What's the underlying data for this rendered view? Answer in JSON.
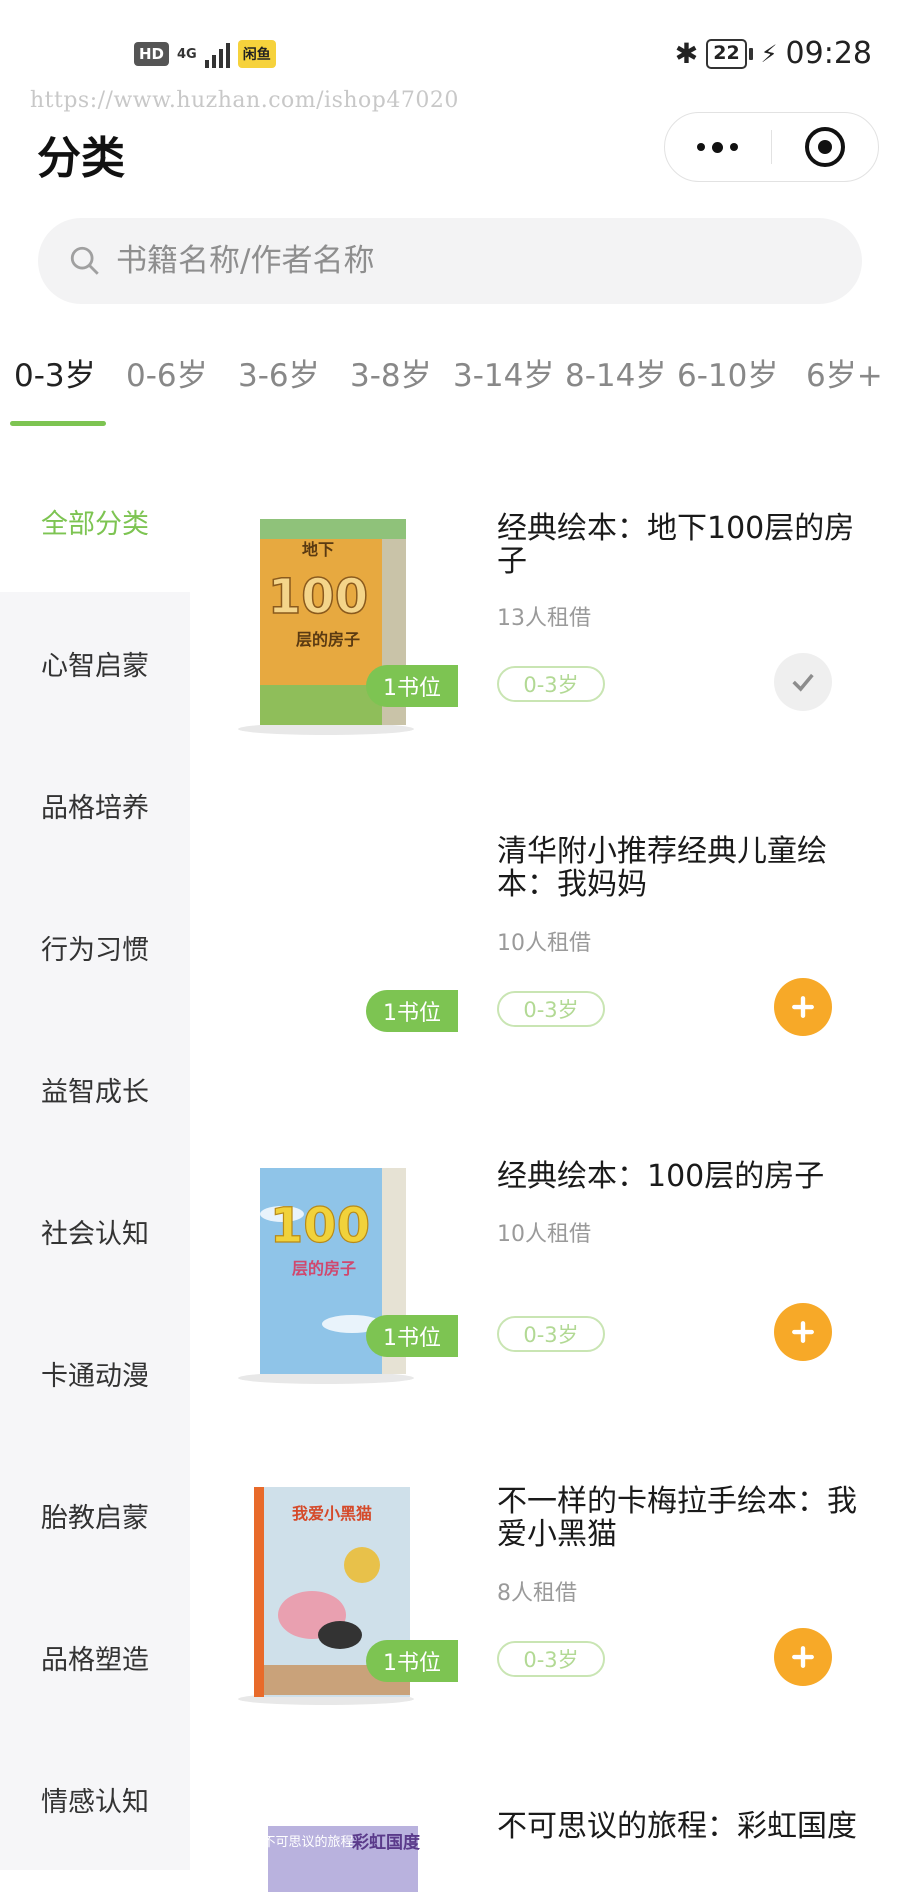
{
  "status_bar": {
    "hd": "HD",
    "network": "4G",
    "app_badge": "闲鱼",
    "battery": "22",
    "time": "09:28",
    "icons": [
      "signal-icon",
      "bluetooth-icon",
      "battery-icon",
      "charging-icon"
    ]
  },
  "watermark": "https://www.huzhan.com/ishop47020",
  "header": {
    "title": "分类",
    "menu_icon": "more-dots-icon",
    "close_icon": "mini-program-close-icon"
  },
  "search": {
    "placeholder": "书籍名称/作者名称",
    "icon": "search-icon"
  },
  "age_tabs": [
    {
      "label": "0-3岁",
      "active": true
    },
    {
      "label": "0-6岁",
      "active": false
    },
    {
      "label": "3-6岁",
      "active": false
    },
    {
      "label": "3-8岁",
      "active": false
    },
    {
      "label": "3-14岁",
      "active": false
    },
    {
      "label": "8-14岁",
      "active": false
    },
    {
      "label": "6-10岁",
      "active": false
    },
    {
      "label": "6岁+",
      "active": false
    }
  ],
  "categories": [
    {
      "label": "全部分类",
      "active": true
    },
    {
      "label": "心智启蒙",
      "active": false
    },
    {
      "label": "品格培养",
      "active": false
    },
    {
      "label": "行为习惯",
      "active": false
    },
    {
      "label": "益智成长",
      "active": false
    },
    {
      "label": "社会认知",
      "active": false
    },
    {
      "label": "卡通动漫",
      "active": false
    },
    {
      "label": "胎教启蒙",
      "active": false
    },
    {
      "label": "品格塑造",
      "active": false
    },
    {
      "label": "情感认知",
      "active": false
    }
  ],
  "books": [
    {
      "title": "经典绘本：地下100层的房子",
      "rent": "13人租借",
      "age": "0-3岁",
      "slot": "1书位",
      "action": "selected",
      "cover_text": [
        "地下",
        "100",
        "层的房子"
      ]
    },
    {
      "title": "清华附小推荐经典儿童绘本：我妈妈",
      "rent": "10人租借",
      "age": "0-3岁",
      "slot": "1书位",
      "action": "add",
      "cover_text": []
    },
    {
      "title": "经典绘本：100层的房子",
      "rent": "10人租借",
      "age": "0-3岁",
      "slot": "1书位",
      "action": "add",
      "cover_text": [
        "100",
        "层的房子"
      ]
    },
    {
      "title": "不一样的卡梅拉手绘本：我爱小黑猫",
      "rent": "8人租借",
      "age": "0-3岁",
      "slot": "1书位",
      "action": "add",
      "cover_text": [
        "我爱小黑猫"
      ]
    },
    {
      "title": "不可思议的旅程：彩虹国度",
      "rent": "",
      "age": "",
      "slot": "",
      "action": "",
      "cover_text": [
        "不可思议的旅程",
        "彩虹国度"
      ]
    }
  ],
  "colors": {
    "accent_green": "#7dc452",
    "add_orange": "#f7a928",
    "sidebar_bg": "#f6f6f8"
  }
}
